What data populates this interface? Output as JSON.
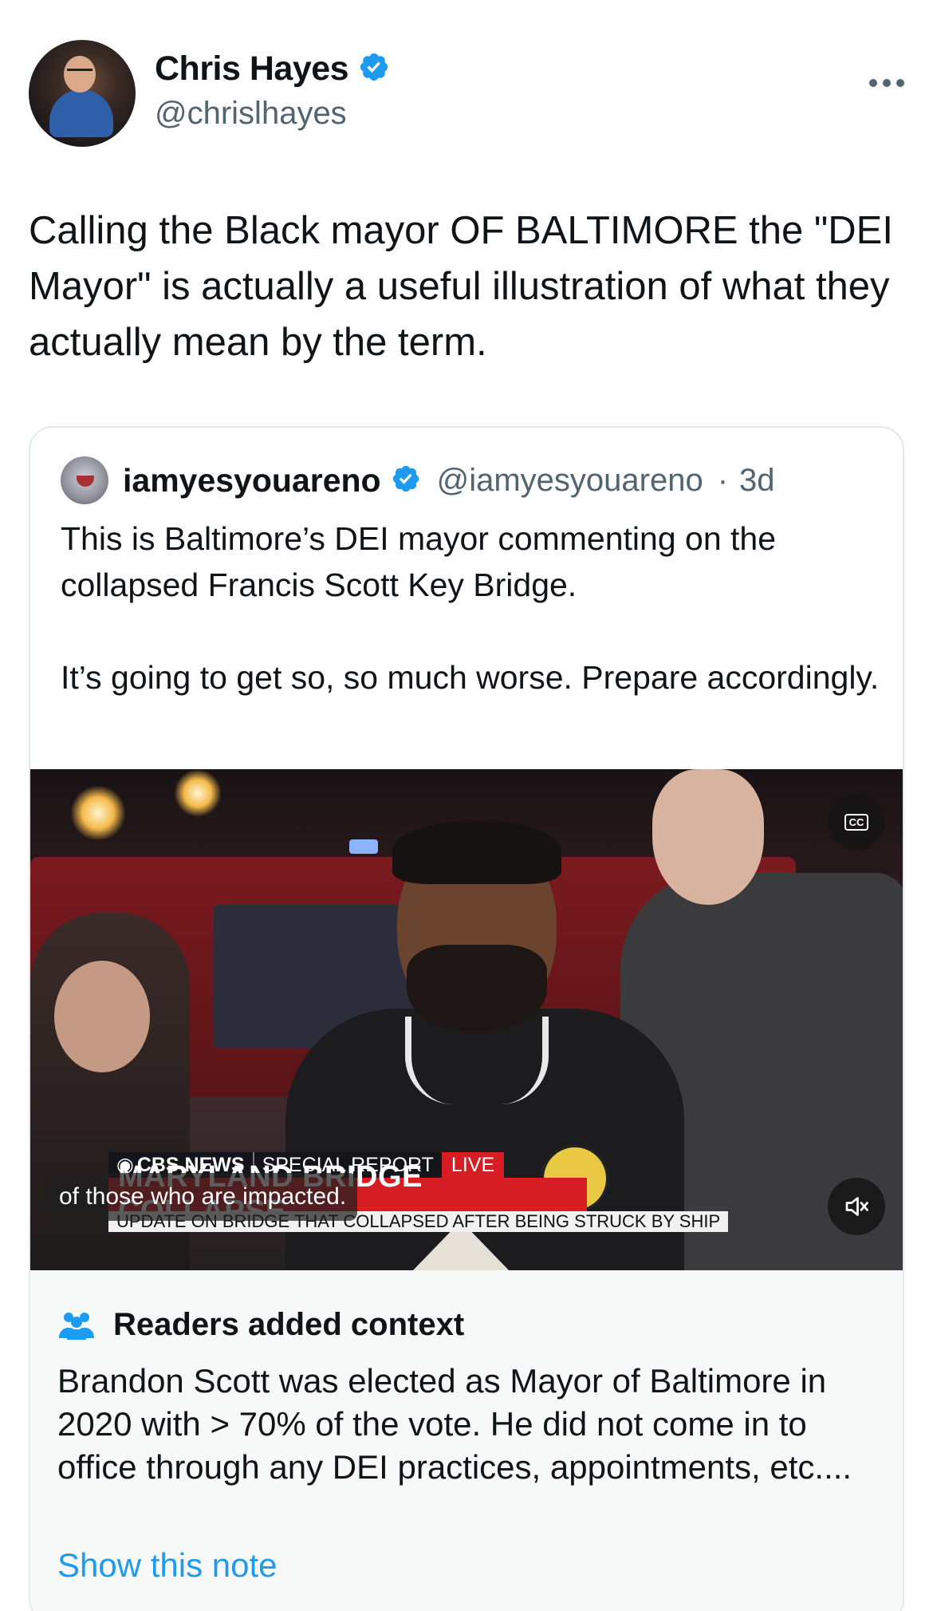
{
  "tweet": {
    "author_name": "Chris Hayes",
    "author_handle": "@chrislhayes",
    "more_icon": "more-horizontal-icon",
    "text": "Calling the Black mayor OF BALTIMORE the \"DEI Mayor\" is actually a useful illustration of what they actually mean by the term."
  },
  "quote": {
    "author_name": "iamyesyouareno",
    "author_handle": "@iamyesyouareno",
    "separator": "·",
    "time": "3d",
    "text_p1": "This is Baltimore’s DEI mayor commenting on the collapsed Francis Scott Key Bridge.",
    "text_p2": "It’s going to get so, so much worse. Prepare accordingly.",
    "video": {
      "chyron_network": "CBS NEWS",
      "chyron_special": "SPECIAL REPORT",
      "chyron_live": "LIVE",
      "chyron_headline": "MARYLAND BRIDGE COLLAPSE",
      "chyron_subline": "UPDATE ON BRIDGE THAT COLLAPSED AFTER BEING STRUCK BY SHIP",
      "caption": "of those who are impacted.",
      "cc_label": "CC",
      "mute_icon": "volume-muted-icon"
    }
  },
  "context": {
    "icon": "people-icon",
    "title": "Readers added context",
    "body": "Brandon Scott was elected as Mayor of Baltimore in 2020 with > 70% of the vote. He did not come in to office through any DEI practices, appointments, etc....",
    "link": "Show this note"
  },
  "colors": {
    "verified_blue": "#1d9bf0",
    "text_primary": "#0f1419",
    "text_secondary": "#536471",
    "cbs_red": "#d51d23"
  }
}
